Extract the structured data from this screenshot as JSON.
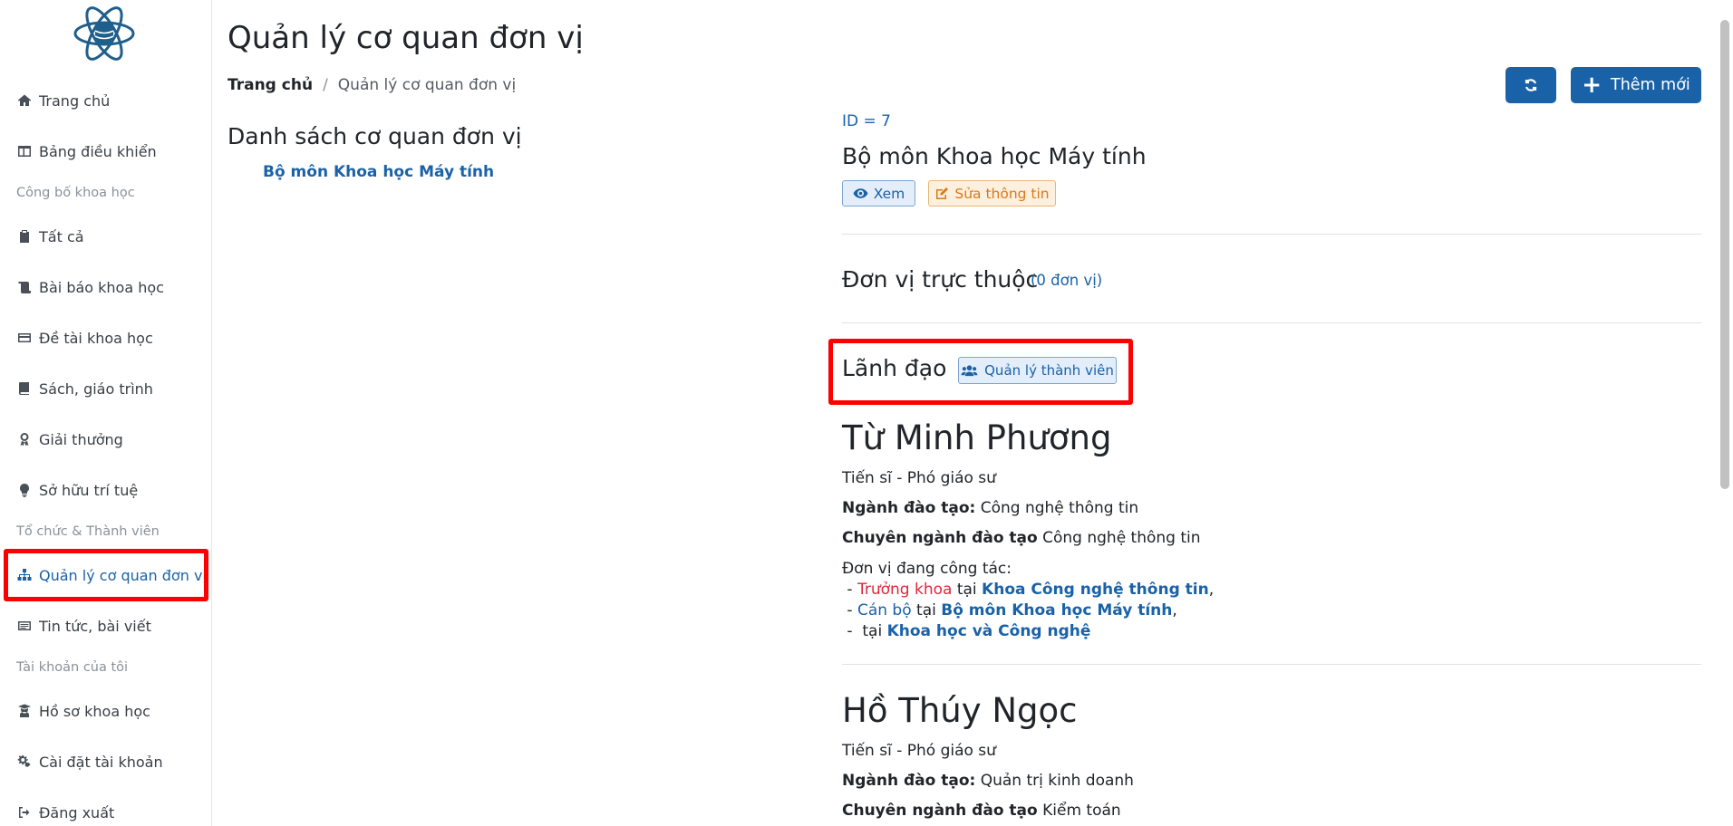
{
  "sidebar": {
    "items": [
      {
        "label": "Trang chủ",
        "icon": "home-icon"
      },
      {
        "label": "Bảng điều khiển",
        "icon": "dashboard-icon"
      },
      {
        "label": "Tất cả",
        "icon": "clipboard-icon"
      },
      {
        "label": "Bài báo khoa học",
        "icon": "scroll-icon"
      },
      {
        "label": "Đề tài khoa học",
        "icon": "card-icon"
      },
      {
        "label": "Sách, giáo trình",
        "icon": "book-icon"
      },
      {
        "label": "Giải thưởng",
        "icon": "award-icon"
      },
      {
        "label": "Sở hữu trí tuệ",
        "icon": "lightbulb-icon"
      },
      {
        "label": "Quản lý cơ quan đơn vị",
        "icon": "sitemap-icon"
      },
      {
        "label": "Tin tức, bài viết",
        "icon": "newspaper-icon"
      },
      {
        "label": "Hồ sơ khoa học",
        "icon": "user-graduate-icon"
      },
      {
        "label": "Cài đặt tài khoản",
        "icon": "gears-icon"
      },
      {
        "label": "Đăng xuất",
        "icon": "sign-out-icon"
      }
    ],
    "sections": [
      "Công bố khoa học",
      "Tổ chức & Thành viên",
      "Tài khoản của tôi"
    ]
  },
  "header": {
    "title": "Quản lý cơ quan đơn vị",
    "breadcrumb_home": "Trang chủ",
    "breadcrumb_sep": "/",
    "breadcrumb_current": "Quản lý cơ quan đơn vị",
    "add_label": "Thêm mới"
  },
  "list": {
    "title": "Danh sách cơ quan đơn vị",
    "items": [
      "Bộ môn Khoa học Máy tính"
    ]
  },
  "detail": {
    "id_label": "ID = 7",
    "name": "Bộ môn Khoa học Máy tính",
    "view_label": "Xem",
    "edit_label": "Sửa thông tin",
    "sub_units_title": "Đơn vị trực thuộc",
    "sub_units_count": "(0 đơn vị)",
    "leaders_title": "Lãnh đạo",
    "manage_members_label": "Quản lý thành viên",
    "field_major": "Ngành đào tạo:",
    "field_specialty": "Chuyên ngành đào tạo",
    "work_units_label": "Đơn vị đang công tác:",
    "at_word": "tại",
    "leaders": [
      {
        "name": "Từ Minh Phương",
        "degree": "Tiến sĩ - Phó giáo sư",
        "major": "Công nghệ thông tin",
        "specialty": "Công nghệ thông tin",
        "positions": [
          {
            "role": "Trưởng khoa",
            "unit": "Khoa Công nghệ thông tin",
            "suffix": ","
          },
          {
            "role": "Cán bộ",
            "unit": "Bộ môn Khoa học Máy tính",
            "suffix": ","
          },
          {
            "role": "",
            "unit": "Khoa học và Công nghệ",
            "suffix": ""
          }
        ]
      },
      {
        "name": "Hồ Thúy Ngọc",
        "degree": "Tiến sĩ - Phó giáo sư",
        "major": "Quản trị kinh doanh",
        "specialty": "Kiểm toán"
      }
    ]
  },
  "colors": {
    "primary": "#1a62a8",
    "highlight": "#ff0000",
    "role_red": "#e0263a",
    "edit_orange": "#d9791a"
  }
}
